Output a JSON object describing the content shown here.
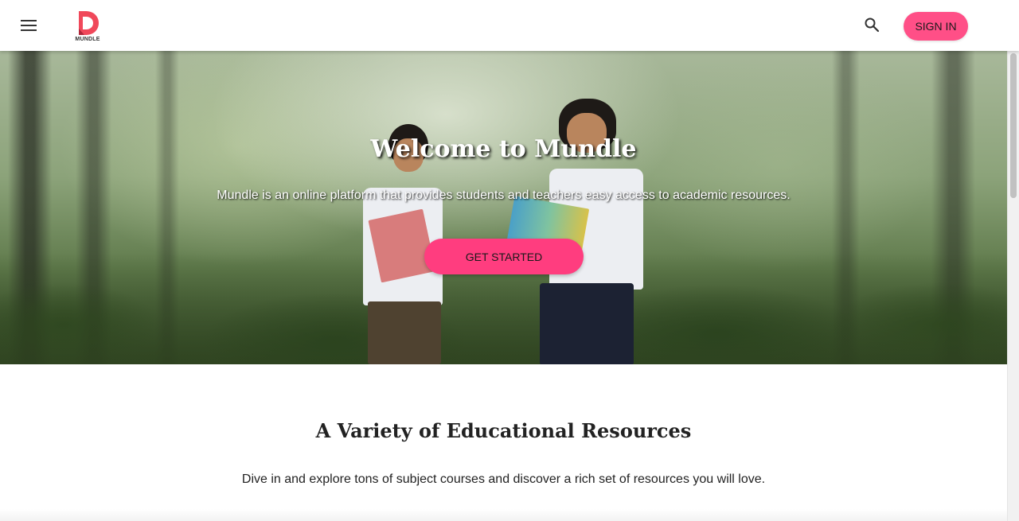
{
  "header": {
    "menu_icon": "hamburger-menu-icon",
    "logo_icon": "mundle-logo-icon",
    "logo_text": "MUNDLE",
    "search_icon": "search-icon",
    "signin_label": "SIGN IN",
    "accent_color": "#ff4f87"
  },
  "hero": {
    "title": "Welcome to Mundle",
    "subtitle": "Mundle is an online platform that provides students and teachers easy access to academic resources.",
    "cta_label": "GET STARTED",
    "image": "children-reading-books-in-forest"
  },
  "section": {
    "title": "A Variety of Educational Resources",
    "text": "Dive in and explore tons of subject courses and discover a rich set of resources you will love."
  }
}
